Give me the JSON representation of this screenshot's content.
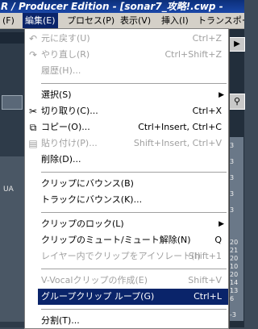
{
  "titlebar": {
    "text": "R / Producer Edition - [sonar7_攻略!.cwp -"
  },
  "menubar": [
    {
      "label": "(F)"
    },
    {
      "label": "編集(E)"
    },
    {
      "label": "プロセス(P)"
    },
    {
      "label": "表示(V)"
    },
    {
      "label": "挿入(I)"
    },
    {
      "label": "トランスポー"
    }
  ],
  "background": {
    "left_label": "UA",
    "right_ticks": [
      "3",
      "3",
      "3",
      "3",
      "3",
      "3",
      "3",
      "3",
      "20",
      "21",
      "20",
      "10",
      "20",
      "14",
      "13",
      "6",
      "-3"
    ]
  },
  "menu": {
    "items": [
      {
        "label": "元に戻す(U)",
        "shortcut": "Ctrl+Z",
        "icon": "undo-icon"
      },
      {
        "label": "やり直し(R)",
        "shortcut": "Ctrl+Shift+Z",
        "icon": "redo-icon"
      },
      {
        "label": "履歴(H)...",
        "shortcut": ""
      },
      {
        "label": "選択(S)",
        "arrow": "▶"
      },
      {
        "label": "切り取り(C)...",
        "shortcut": "Ctrl+X",
        "icon": "scissors-icon"
      },
      {
        "label": "コピー(O)...",
        "shortcut": "Ctrl+Insert, Ctrl+C",
        "icon": "copy-icon"
      },
      {
        "label": "貼り付け(P)...",
        "shortcut": "Shift+Insert, Ctrl+V",
        "icon": "paste-icon"
      },
      {
        "label": "削除(D)...",
        "shortcut": ""
      },
      {
        "label": "クリップにバウンス(B)",
        "shortcut": ""
      },
      {
        "label": "トラックにバウンス(K)...",
        "shortcut": ""
      },
      {
        "label": "クリップのロック(L)",
        "arrow": "▶"
      },
      {
        "label": "クリップのミュート/ミュート解除(N)",
        "shortcut": "Q"
      },
      {
        "label": "レイヤー内でクリップをアイソレート(I)",
        "shortcut": "Shift+1"
      },
      {
        "label": "V-Vocalクリップの作成(E)",
        "shortcut": "Shift+V"
      },
      {
        "label": "グループクリップ ループ(G)",
        "shortcut": "Ctrl+L"
      },
      {
        "label": "分割(T)...",
        "shortcut": ""
      }
    ]
  },
  "colors": {
    "highlight": "#0a246a",
    "disabled_text": "#a0a0a0"
  }
}
